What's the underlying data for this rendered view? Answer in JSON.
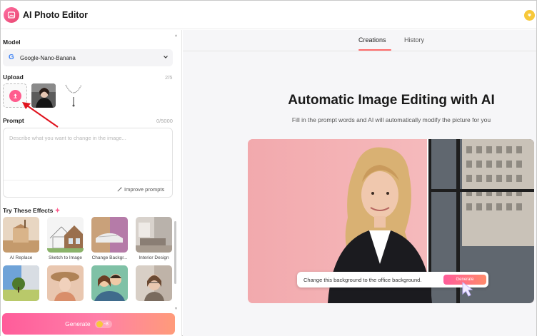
{
  "header": {
    "title": "AI Photo Editor",
    "logo_icon": "photo-edit-icon",
    "coin_icon": "coin-icon"
  },
  "sidebar": {
    "model_label": "Model",
    "model_value": "Google-Nano-Banana",
    "upload_label": "Upload",
    "upload_count": "2/5",
    "prompt_label": "Prompt",
    "prompt_count": "0/5000",
    "prompt_placeholder": "Describe what you want to change in the image...",
    "improve_label": "Improve prompts",
    "effects_label": "Try These Effects",
    "effects": [
      {
        "label": "AI Replace"
      },
      {
        "label": "Sketch to Image"
      },
      {
        "label": "Change Backgr..."
      },
      {
        "label": "Interior Design"
      },
      {
        "label": ""
      },
      {
        "label": ""
      },
      {
        "label": ""
      },
      {
        "label": ""
      }
    ],
    "generate_label": "Generate",
    "generate_cost": "-8"
  },
  "main": {
    "tabs": [
      {
        "label": "Creations",
        "active": true
      },
      {
        "label": "History",
        "active": false
      }
    ],
    "hero_title": "Automatic Image Editing with AI",
    "hero_subtitle": "Fill in the prompt words and AI will automatically modify the picture for you",
    "demo_prompt": "Change this background to the office background.",
    "demo_generate": "Generate"
  },
  "colors": {
    "accent": "#ff5c8e",
    "coin": "#f7c83a",
    "tab_underline": "#ff6b6b"
  }
}
